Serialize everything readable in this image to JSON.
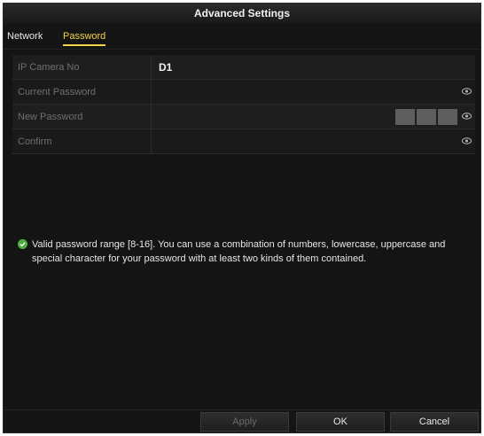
{
  "window": {
    "title": "Advanced Settings"
  },
  "tabs": [
    {
      "label": "Network",
      "active": false
    },
    {
      "label": "Password",
      "active": true
    }
  ],
  "form": {
    "ip_camera_no": {
      "label": "IP Camera No",
      "value": "D1"
    },
    "current_password": {
      "label": "Current Password",
      "value": "",
      "icon": "eye-icon"
    },
    "new_password": {
      "label": "New Password",
      "value": "",
      "icon": "eye-icon",
      "strength_segments": 3
    },
    "confirm": {
      "label": "Confirm",
      "value": "",
      "icon": "eye-icon"
    }
  },
  "hint": {
    "text": "Valid password range [8-16]. You can use a combination of numbers, lowercase, uppercase and special character for your password with at least two kinds of them contained.",
    "icon": "check-circle-icon"
  },
  "buttons": {
    "apply": "Apply",
    "ok": "OK",
    "cancel": "Cancel"
  },
  "colors": {
    "active_tab": "#f2d44a",
    "hint_icon": "#4cae3f",
    "background": "#141414"
  }
}
